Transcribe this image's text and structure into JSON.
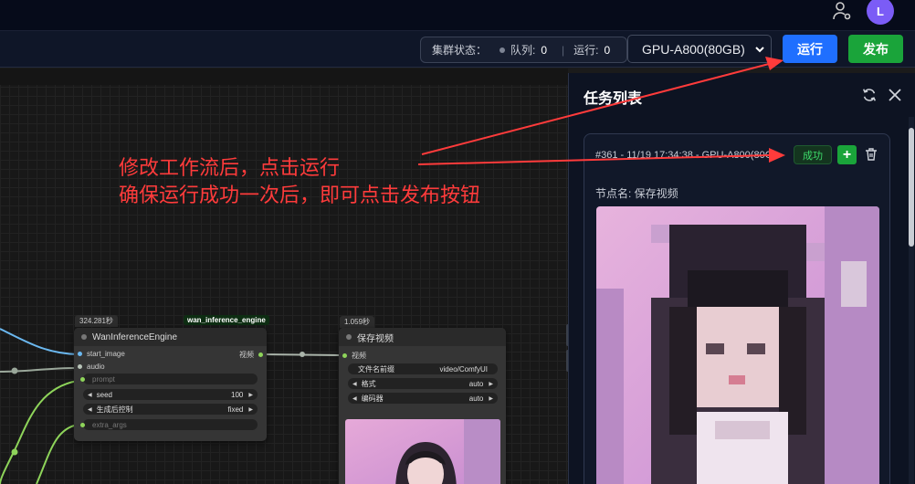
{
  "header": {
    "avatar_letter": "L"
  },
  "toolbar": {
    "cluster_label": "集群状态：",
    "queue_label": "队列:",
    "queue_count": "0",
    "running_label": "运行:",
    "running_count": "0",
    "gpu_selected": "GPU-A800(80GB)",
    "run_label": "运行",
    "publish_label": "发布"
  },
  "annotation": {
    "line1": "修改工作流后，点击运行",
    "line2": "确保运行成功一次后，即可点击发布按钮",
    "color": "#ff3b3b"
  },
  "nodes": {
    "wan": {
      "time": "324.281秒",
      "tag": "wan_inference_engine",
      "title": "WanInferenceEngine",
      "inputs": [
        "start_image",
        "audio"
      ],
      "output": "视频",
      "prompt_label": "prompt",
      "seed_label": "seed",
      "seed_value": "100",
      "control_label": "生成后控制",
      "control_value": "fixed",
      "extra_label": "extra_args"
    },
    "save": {
      "time": "1.059秒",
      "title": "保存视频",
      "input": "视频",
      "prefix_label": "文件名前缀",
      "prefix_value": "video/ComfyUI",
      "format_label": "格式",
      "format_value": "auto",
      "codec_label": "编码器",
      "codec_value": "auto"
    }
  },
  "panel": {
    "title": "任务列表",
    "task": {
      "id_text": "#361 - 11/19 17:34:38 - GPU-A800(80GB)",
      "status": "成功",
      "add_label": "+",
      "node_name": "节点名: 保存视频"
    }
  },
  "colors": {
    "run": "#1f6fff",
    "publish": "#1aa43a",
    "success": "#3ddc6a"
  }
}
